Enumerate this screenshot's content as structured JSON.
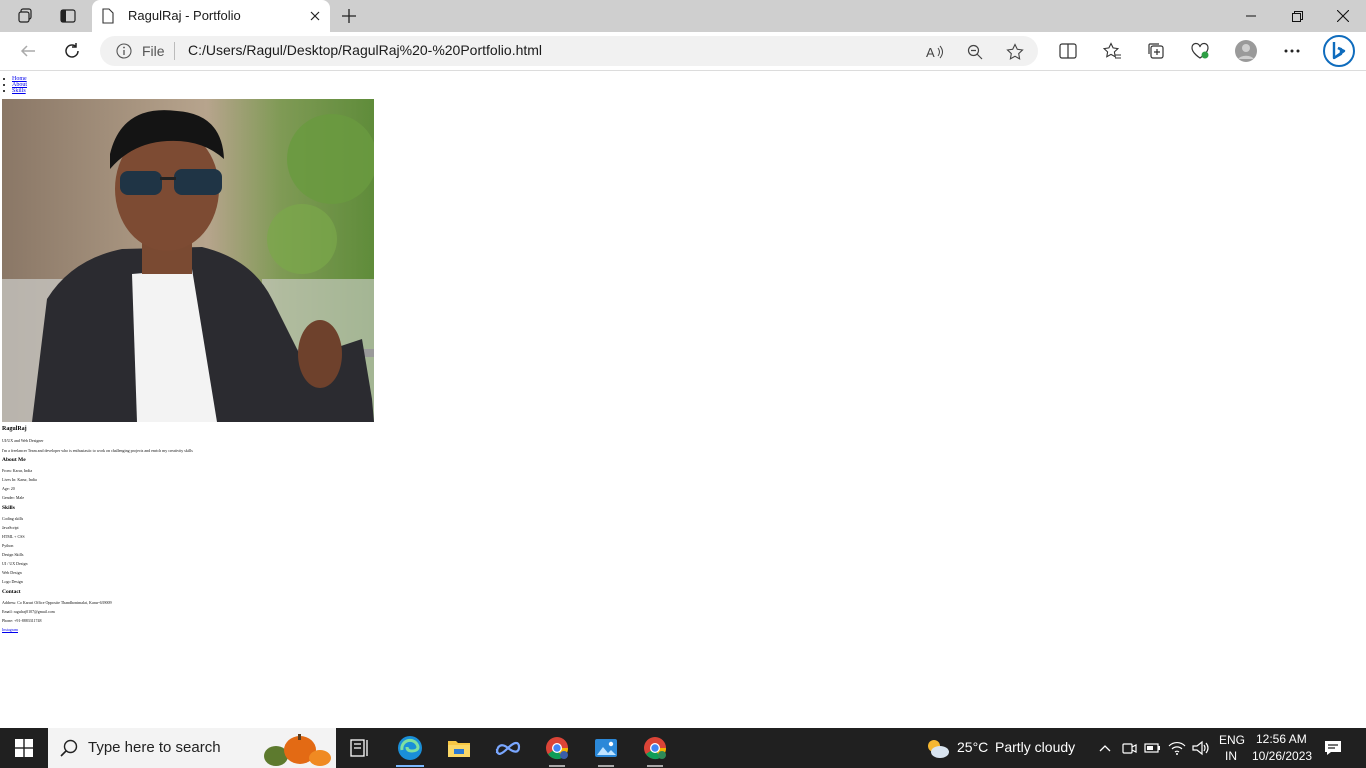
{
  "browser": {
    "tab_title": "RagulRaj - Portfolio",
    "address_prefix": "File",
    "url": "C:/Users/Ragul/Desktop/RagulRaj%20-%20Portfolio.html"
  },
  "page": {
    "nav": [
      "Home",
      "About",
      "Skills"
    ],
    "name": "RagulRaj",
    "role": "UI/UX and Web Designer",
    "intro": "I'm a freelancer Team and developer who is enthusiastic to work on challenging projects and enrich my creativity skills",
    "about_heading": "About Me",
    "about": [
      "From: Karur, India",
      "Lives In: Karur, India",
      "Age: 20",
      "Gender: Male"
    ],
    "skills_heading": "Skills",
    "skills": [
      "Coding skills",
      "JavaScript",
      "HTML + CSS",
      "Python",
      "Design Skills",
      "UI / UX Design",
      "Web Design",
      "Logo Design"
    ],
    "contact_heading": "Contact",
    "contact": [
      "Address: Co Karuri Office Opposite Thandhonimalai, Karur-639009",
      "Email: ragulraj0107@gmail.com",
      "Phone: +91-8883311748"
    ],
    "link": "Instagram"
  },
  "taskbar": {
    "search_placeholder": "Type here to search",
    "weather_temp": "25°C",
    "weather_desc": "Partly cloudy",
    "lang_top": "ENG",
    "lang_bottom": "IN",
    "time": "12:56 AM",
    "date": "10/26/2023"
  },
  "colors": {
    "link": "#0000ee",
    "taskbar": "#202020",
    "edge_accent": "#0f6cbd"
  }
}
